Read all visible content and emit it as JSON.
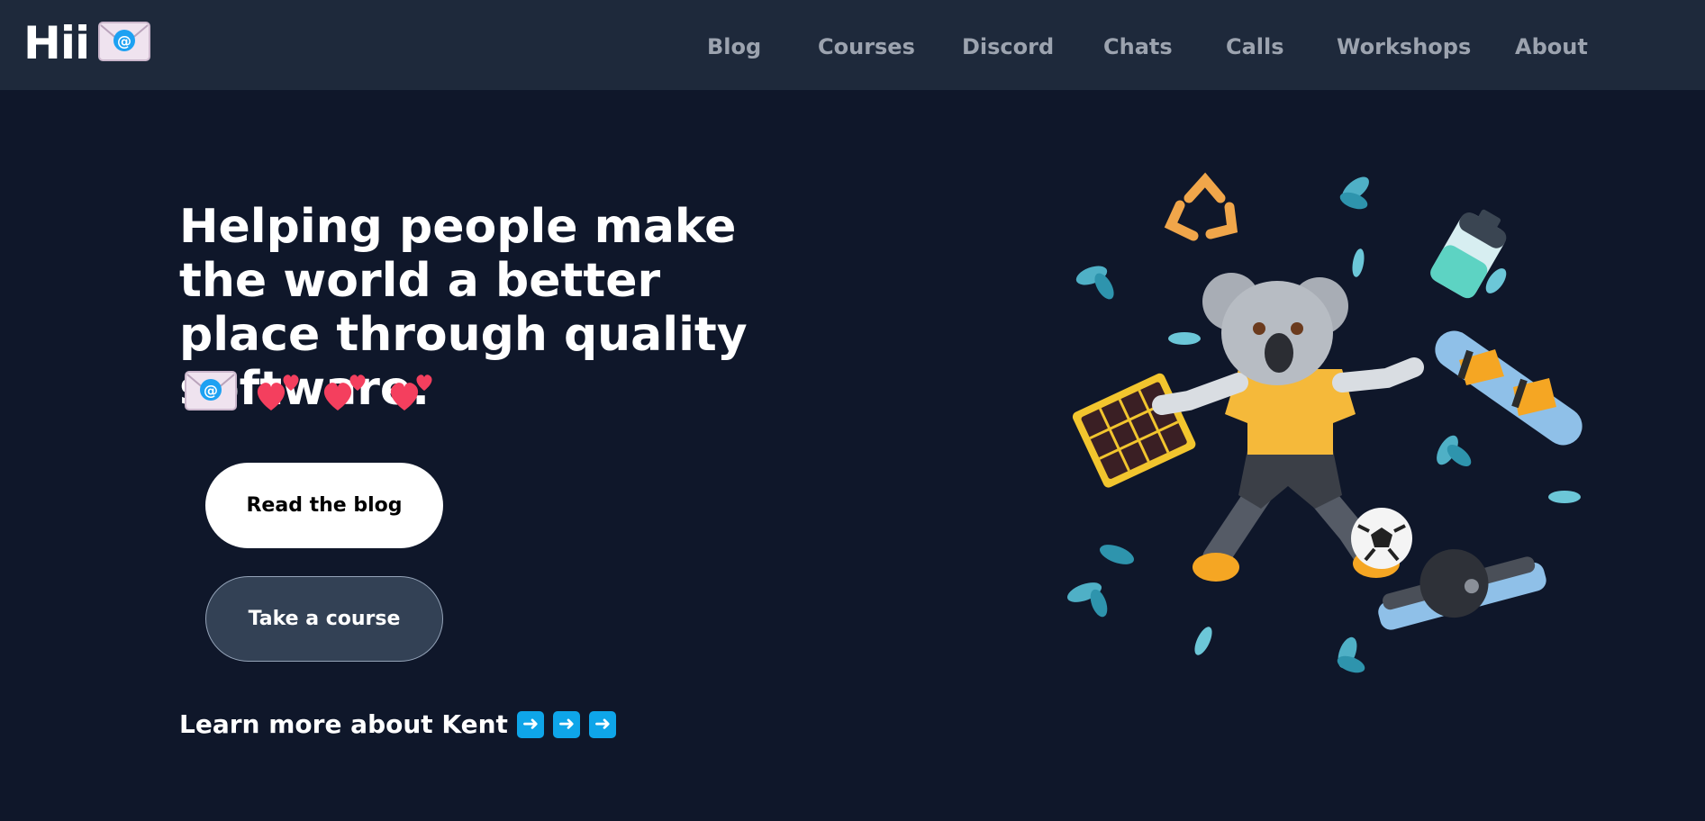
{
  "header": {
    "logo_text": "Hii",
    "logo_icon": "envelope-with-at-icon",
    "nav": [
      {
        "label": "Blog"
      },
      {
        "label": "Courses"
      },
      {
        "label": "Discord"
      },
      {
        "label": "Chats"
      },
      {
        "label": "Calls"
      },
      {
        "label": "Workshops"
      },
      {
        "label": "About"
      }
    ]
  },
  "hero": {
    "title": "Helping people make the world a better place through quality software.",
    "emoji_icons": [
      "envelope-with-at-icon",
      "two-hearts-icon",
      "two-hearts-icon",
      "two-hearts-icon"
    ],
    "primary_button": "Read the blog",
    "secondary_button": "Take a course",
    "learn_more": "Learn more about Kent",
    "arrow_icons": [
      "right-arrow-icon",
      "right-arrow-icon",
      "right-arrow-icon"
    ]
  },
  "illustration": {
    "icon": "koala-soccer-illustration"
  },
  "colors": {
    "background": "#0f172a",
    "nav_background": "#1e293b",
    "nav_text": "#9ca3af",
    "accent_arrow": "#0ea5e9",
    "heart": "#f43f5e"
  }
}
